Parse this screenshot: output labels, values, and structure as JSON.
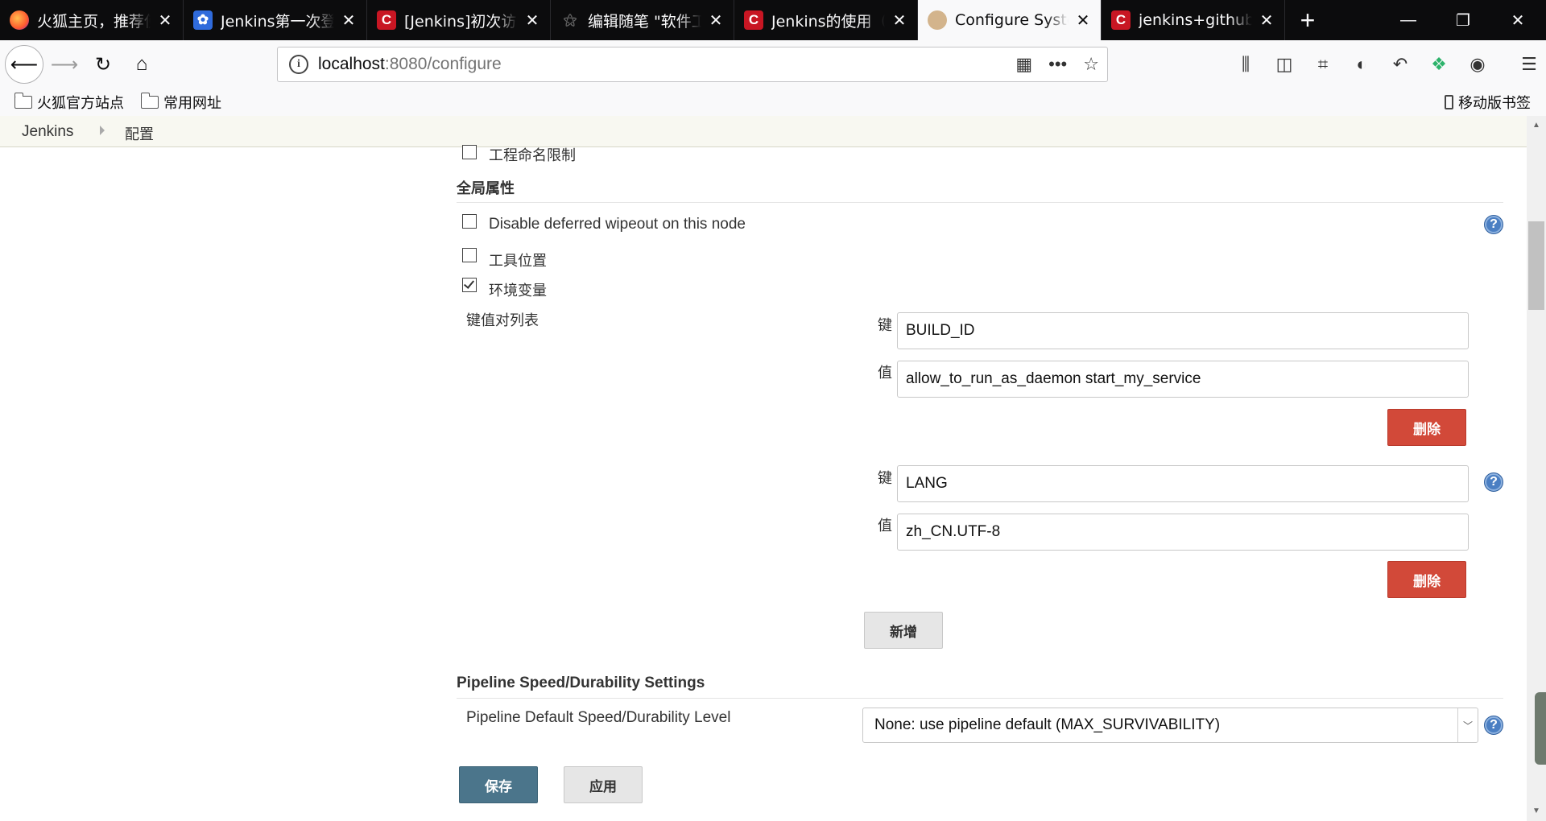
{
  "tabs": [
    {
      "title": "火狐主页，推荐使用",
      "favicon": "firefox-icon",
      "active": false
    },
    {
      "title": "Jenkins第一次登录",
      "favicon": "baidu-paw-icon",
      "active": false
    },
    {
      "title": "[Jenkins]初次访问",
      "favicon": "csdn-icon",
      "active": false
    },
    {
      "title": "编辑随笔 \"软件工程",
      "favicon": "cnblogs-icon",
      "active": false
    },
    {
      "title": "Jenkins的使用（",
      "favicon": "csdn-icon",
      "active": false
    },
    {
      "title": "Configure System",
      "favicon": "jenkins-icon",
      "active": true
    },
    {
      "title": "jenkins+github",
      "favicon": "csdn-icon",
      "active": false
    }
  ],
  "url": {
    "host": "localhost",
    "path": ":8080/configure"
  },
  "bookmarks": {
    "items": [
      "火狐官方站点",
      "常用网址"
    ],
    "mobile": "移动版书签"
  },
  "breadcrumbs": [
    "Jenkins",
    "配置"
  ],
  "form": {
    "project_naming_label": "工程命名限制",
    "global_properties_title": "全局属性",
    "disable_wipeout_label": "Disable deferred wipeout on this node",
    "tool_locations_label": "工具位置",
    "env_vars_label": "环境变量",
    "env_vars_checked": true,
    "kv_list_label": "键值对列表",
    "key_label": "键",
    "value_label": "值",
    "env_entries": [
      {
        "key": "BUILD_ID",
        "value": "allow_to_run_as_daemon start_my_service"
      },
      {
        "key": "LANG",
        "value": "zh_CN.UTF-8"
      }
    ],
    "delete_label": "删除",
    "add_label": "新增",
    "pipeline_title": "Pipeline Speed/Durability Settings",
    "pipeline_level_label": "Pipeline Default Speed/Durability Level",
    "pipeline_level_value": "None: use pipeline default (MAX_SURVIVABILITY)",
    "save_label": "保存",
    "apply_label": "应用"
  },
  "colors": {
    "tabstrip": "#0c0c0d",
    "danger_button": "#d24939",
    "primary_button": "#4b758b",
    "help_icon": "#4b7fc3"
  }
}
